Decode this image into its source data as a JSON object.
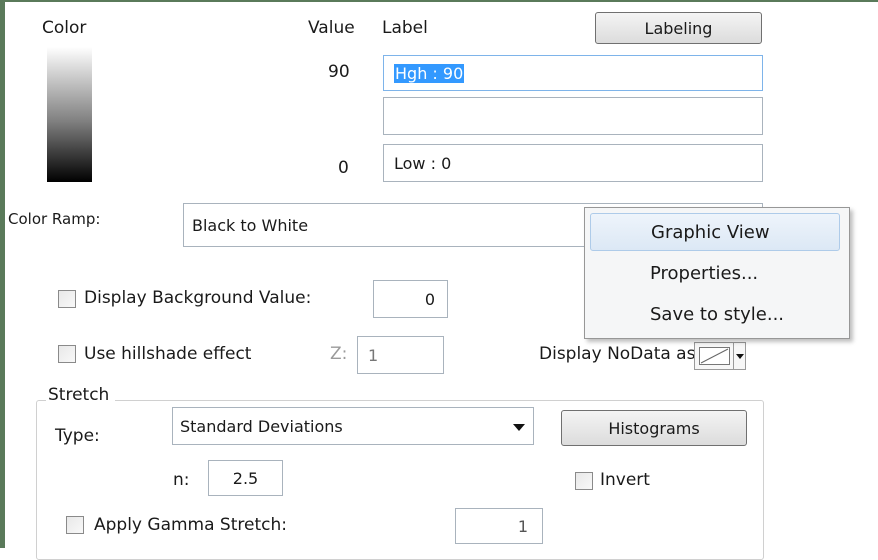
{
  "headers": {
    "color": "Color",
    "value": "Value",
    "label": "Label"
  },
  "labeling_button": "Labeling",
  "rows": [
    {
      "value": "90",
      "label": "Hgh : 90"
    },
    {
      "value": "",
      "label": ""
    },
    {
      "value": "0",
      "label": "Low : 0"
    }
  ],
  "color_ramp": {
    "label": "Color Ramp:",
    "value": "Black to White"
  },
  "context_menu": {
    "items": [
      "Graphic View",
      "Properties...",
      "Save to style..."
    ],
    "highlighted": "Graphic View"
  },
  "background_value": {
    "label": "Display Background Value:",
    "value": "0",
    "checked": false
  },
  "hillshade": {
    "label": "Use hillshade effect",
    "z_label": "Z:",
    "z_value": "1",
    "checked": false
  },
  "nodata": {
    "label": "Display NoData as"
  },
  "stretch": {
    "group_title": "Stretch",
    "type_label": "Type:",
    "type_value": "Standard Deviations",
    "histograms_button": "Histograms",
    "n_label": "n:",
    "n_value": "2.5",
    "invert_label": "Invert",
    "invert_checked": false,
    "gamma_label": "Apply Gamma Stretch:",
    "gamma_value": "1",
    "gamma_checked": false
  }
}
